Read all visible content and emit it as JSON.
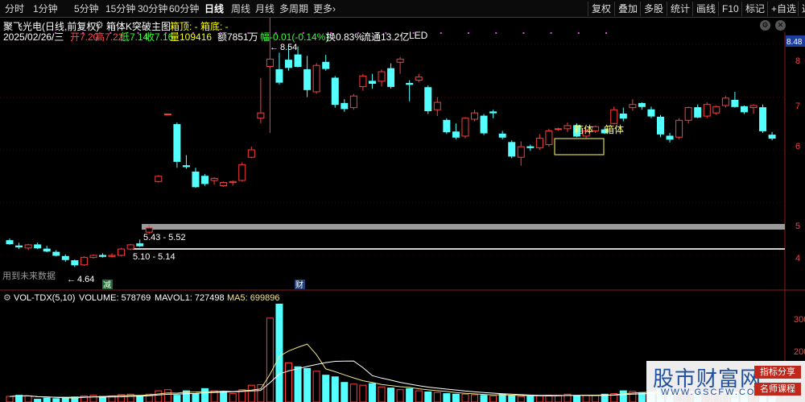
{
  "toolbar": {
    "periods": [
      "分时",
      "1分钟",
      "5分钟",
      "15分钟",
      "30分钟",
      "60分钟",
      "日线",
      "周线",
      "月线",
      "多周期",
      "更多"
    ],
    "active": "日线",
    "more_arrow": "›",
    "right": [
      "复权",
      "叠加",
      "多股",
      "统计",
      "画线",
      "F10",
      "标记",
      "+自选",
      "返回"
    ]
  },
  "header": {
    "stock": "聚飞光电(日线,前复权)",
    "indicator": "箱体K突破主图",
    "box_top": "箱顶: -",
    "box_bottom": "箱底: -",
    "line2": {
      "date": "2025/02/26/三",
      "open": "开7.20",
      "high": "高7.22",
      "low": "低7.14",
      "close": "收7.16",
      "volume": "量109416",
      "amount": "额7851万",
      "change": "幅-0.01(-0.14%)",
      "turnover": "换0.83%",
      "float": "流通13.2亿",
      "sector": "LED"
    }
  },
  "price_axis": {
    "ticks": [
      "8",
      "7",
      "6",
      "5",
      "4"
    ],
    "current": "8.48"
  },
  "annotations": {
    "high_label": "8.54",
    "low_label": "4.64",
    "range1": "5.43 - 5.52",
    "range2": "5.10 - 5.14",
    "box_label1": "箱体",
    "box_label2": "箱体",
    "future_data": "用到未来数据",
    "marker_reduce": "减",
    "marker_fin": "财"
  },
  "volume_header": {
    "name": "VOL-TDX(5,10)",
    "volume": "VOLUME: 578769",
    "mavol1": "MAVOL1: 727498",
    "ma5": "MA5: 699896"
  },
  "volume_axis": {
    "ticks": [
      "300",
      "200"
    ]
  },
  "watermark": {
    "title": "股市财富网",
    "url": "WWW.GSCFW.COM",
    "tag1": "指标分享",
    "tag2": "名师课程"
  },
  "colors": {
    "up": "#ff3c3c",
    "down": "#54ffff",
    "mavol": "#ffffff",
    "ma5": "#f0e68c",
    "box_line": "#999999",
    "dots": "#e040e0"
  },
  "chart_data": {
    "type": "candlestick",
    "candles": [
      {
        "o": 4.28,
        "h": 4.32,
        "l": 4.2,
        "c": 4.22
      },
      {
        "o": 4.18,
        "h": 4.24,
        "l": 4.12,
        "c": 4.16
      },
      {
        "o": 4.14,
        "h": 4.22,
        "l": 4.1,
        "c": 4.2
      },
      {
        "o": 4.2,
        "h": 4.24,
        "l": 4.12,
        "c": 4.14
      },
      {
        "o": 4.12,
        "h": 4.18,
        "l": 4.06,
        "c": 4.08
      },
      {
        "o": 4.06,
        "h": 4.1,
        "l": 3.98,
        "c": 4.0
      },
      {
        "o": 3.98,
        "h": 4.02,
        "l": 3.88,
        "c": 3.92
      },
      {
        "o": 3.9,
        "h": 3.92,
        "l": 3.78,
        "c": 3.82
      },
      {
        "o": 3.82,
        "h": 3.98,
        "l": 3.8,
        "c": 3.96
      },
      {
        "o": 3.96,
        "h": 4.02,
        "l": 3.94,
        "c": 4.0
      },
      {
        "o": 4.0,
        "h": 4.04,
        "l": 3.96,
        "c": 3.98
      },
      {
        "o": 3.98,
        "h": 4.04,
        "l": 3.96,
        "c": 4.0
      },
      {
        "o": 4.0,
        "h": 4.14,
        "l": 3.98,
        "c": 4.12
      },
      {
        "o": 4.12,
        "h": 4.22,
        "l": 4.1,
        "c": 4.2
      },
      {
        "o": 4.22,
        "h": 4.3,
        "l": 4.16,
        "c": 4.18
      },
      {
        "o": 4.44,
        "h": 4.58,
        "l": 4.4,
        "c": 4.52
      },
      {
        "o": 5.4,
        "h": 5.52,
        "l": 5.38,
        "c": 5.5
      },
      {
        "o": 6.68,
        "h": 6.68,
        "l": 6.68,
        "c": 6.68
      },
      {
        "o": 6.48,
        "h": 6.52,
        "l": 5.66,
        "c": 5.78
      },
      {
        "o": 5.7,
        "h": 5.9,
        "l": 5.64,
        "c": 5.68
      },
      {
        "o": 5.58,
        "h": 5.66,
        "l": 5.28,
        "c": 5.3
      },
      {
        "o": 5.5,
        "h": 5.54,
        "l": 5.32,
        "c": 5.36
      },
      {
        "o": 5.42,
        "h": 5.48,
        "l": 5.34,
        "c": 5.46
      },
      {
        "o": 5.32,
        "h": 5.4,
        "l": 5.3,
        "c": 5.38
      },
      {
        "o": 5.38,
        "h": 5.42,
        "l": 5.32,
        "c": 5.4
      },
      {
        "o": 5.42,
        "h": 5.76,
        "l": 5.4,
        "c": 5.72
      },
      {
        "o": 5.86,
        "h": 6.06,
        "l": 5.84,
        "c": 6.0
      },
      {
        "o": 6.6,
        "h": 7.36,
        "l": 6.5,
        "c": 6.7
      },
      {
        "o": 7.58,
        "h": 8.54,
        "l": 6.32,
        "c": 7.72
      },
      {
        "o": 7.52,
        "h": 7.84,
        "l": 7.24,
        "c": 7.28
      },
      {
        "o": 7.7,
        "h": 8.0,
        "l": 7.5,
        "c": 7.56
      },
      {
        "o": 7.8,
        "h": 7.96,
        "l": 7.56,
        "c": 7.58
      },
      {
        "o": 7.52,
        "h": 7.78,
        "l": 7.0,
        "c": 7.14
      },
      {
        "o": 7.1,
        "h": 7.64,
        "l": 7.06,
        "c": 7.6
      },
      {
        "o": 7.66,
        "h": 7.8,
        "l": 7.5,
        "c": 7.54
      },
      {
        "o": 7.36,
        "h": 7.4,
        "l": 6.8,
        "c": 6.86
      },
      {
        "o": 6.88,
        "h": 6.96,
        "l": 6.72,
        "c": 6.78
      },
      {
        "o": 6.8,
        "h": 7.06,
        "l": 6.76,
        "c": 7.02
      },
      {
        "o": 7.2,
        "h": 7.44,
        "l": 7.12,
        "c": 7.4
      },
      {
        "o": 7.3,
        "h": 7.44,
        "l": 7.16,
        "c": 7.26
      },
      {
        "o": 7.3,
        "h": 7.52,
        "l": 7.2,
        "c": 7.48
      },
      {
        "o": 7.54,
        "h": 7.64,
        "l": 7.16,
        "c": 7.2
      },
      {
        "o": 7.66,
        "h": 7.76,
        "l": 7.44,
        "c": 7.72
      },
      {
        "o": 7.26,
        "h": 7.32,
        "l": 6.92,
        "c": 7.24
      },
      {
        "o": 7.32,
        "h": 7.44,
        "l": 7.28,
        "c": 7.38
      },
      {
        "o": 7.18,
        "h": 7.22,
        "l": 6.68,
        "c": 6.74
      },
      {
        "o": 6.76,
        "h": 7.0,
        "l": 6.64,
        "c": 6.9
      },
      {
        "o": 6.56,
        "h": 6.6,
        "l": 6.3,
        "c": 6.34
      },
      {
        "o": 6.34,
        "h": 6.5,
        "l": 6.2,
        "c": 6.24
      },
      {
        "o": 6.26,
        "h": 6.62,
        "l": 6.22,
        "c": 6.6
      },
      {
        "o": 6.58,
        "h": 6.76,
        "l": 6.54,
        "c": 6.7
      },
      {
        "o": 6.64,
        "h": 6.68,
        "l": 6.28,
        "c": 6.32
      },
      {
        "o": 6.72,
        "h": 6.76,
        "l": 6.6,
        "c": 6.7
      },
      {
        "o": 6.3,
        "h": 6.36,
        "l": 6.2,
        "c": 6.24
      },
      {
        "o": 6.14,
        "h": 6.18,
        "l": 5.84,
        "c": 5.88
      },
      {
        "o": 5.86,
        "h": 6.16,
        "l": 5.7,
        "c": 6.06
      },
      {
        "o": 6.06,
        "h": 6.1,
        "l": 5.98,
        "c": 6.04
      },
      {
        "o": 6.04,
        "h": 6.3,
        "l": 6.0,
        "c": 6.22
      },
      {
        "o": 6.1,
        "h": 6.4,
        "l": 6.06,
        "c": 6.36
      },
      {
        "o": 6.4,
        "h": 6.42,
        "l": 6.36,
        "c": 6.4
      },
      {
        "o": 6.4,
        "h": 6.52,
        "l": 6.34,
        "c": 6.46
      },
      {
        "o": 6.46,
        "h": 6.5,
        "l": 6.24,
        "c": 6.26
      },
      {
        "o": 6.26,
        "h": 6.4,
        "l": 6.22,
        "c": 6.36
      },
      {
        "o": 6.36,
        "h": 6.46,
        "l": 6.32,
        "c": 6.44
      },
      {
        "o": 6.38,
        "h": 6.44,
        "l": 6.3,
        "c": 6.32
      },
      {
        "o": 6.5,
        "h": 6.82,
        "l": 6.48,
        "c": 6.76
      },
      {
        "o": 6.68,
        "h": 6.8,
        "l": 6.54,
        "c": 6.6
      },
      {
        "o": 6.8,
        "h": 6.96,
        "l": 6.74,
        "c": 6.86
      },
      {
        "o": 6.88,
        "h": 6.9,
        "l": 6.76,
        "c": 6.82
      },
      {
        "o": 6.76,
        "h": 6.82,
        "l": 6.6,
        "c": 6.64
      },
      {
        "o": 6.62,
        "h": 6.66,
        "l": 6.24,
        "c": 6.3
      },
      {
        "o": 6.26,
        "h": 6.32,
        "l": 6.14,
        "c": 6.2
      },
      {
        "o": 6.24,
        "h": 6.6,
        "l": 6.2,
        "c": 6.56
      },
      {
        "o": 6.56,
        "h": 6.82,
        "l": 6.5,
        "c": 6.8
      },
      {
        "o": 6.8,
        "h": 6.86,
        "l": 6.6,
        "c": 6.62
      },
      {
        "o": 6.64,
        "h": 6.9,
        "l": 6.6,
        "c": 6.86
      },
      {
        "o": 6.7,
        "h": 6.84,
        "l": 6.66,
        "c": 6.82
      },
      {
        "o": 6.84,
        "h": 7.02,
        "l": 6.8,
        "c": 6.98
      },
      {
        "o": 6.94,
        "h": 7.1,
        "l": 6.8,
        "c": 6.82
      },
      {
        "o": 6.82,
        "h": 6.84,
        "l": 6.68,
        "c": 6.72
      },
      {
        "o": 6.8,
        "h": 6.86,
        "l": 6.68,
        "c": 6.84
      },
      {
        "o": 6.8,
        "h": 6.86,
        "l": 6.32,
        "c": 6.36
      },
      {
        "o": 6.28,
        "h": 6.34,
        "l": 6.18,
        "c": 6.22
      }
    ],
    "volume_max": 360,
    "volume_max_note": "in 10k",
    "volumes_up": [
      20,
      24,
      22,
      10,
      14,
      12,
      16,
      18,
      22,
      24,
      20,
      22,
      26,
      28,
      22,
      28,
      40,
      44,
      24,
      40,
      30,
      48,
      40,
      38,
      30,
      44,
      60,
      62,
      300,
      350,
      140,
      126,
      120,
      110,
      96,
      90,
      70,
      64,
      60,
      66,
      54,
      50,
      44,
      48,
      40,
      36,
      34,
      30,
      28,
      28,
      26,
      24,
      22,
      28,
      22,
      20,
      20,
      22,
      24,
      24,
      28,
      22,
      24,
      24,
      28,
      30,
      40,
      38,
      34,
      36,
      44,
      36,
      32,
      30,
      30,
      36,
      38,
      32,
      34,
      44,
      46,
      40,
      38
    ],
    "volumes_color": [
      "u",
      "d",
      "u",
      "d",
      "d",
      "d",
      "d",
      "d",
      "u",
      "u",
      "d",
      "u",
      "u",
      "u",
      "d",
      "u",
      "u",
      "u",
      "d",
      "d",
      "d",
      "d",
      "u",
      "d",
      "u",
      "u",
      "u",
      "u",
      "u",
      "d",
      "u",
      "d",
      "d",
      "u",
      "d",
      "d",
      "d",
      "u",
      "u",
      "d",
      "u",
      "d",
      "u",
      "d",
      "u",
      "d",
      "u",
      "d",
      "d",
      "u",
      "u",
      "d",
      "u",
      "d",
      "d",
      "u",
      "d",
      "u",
      "u",
      "u",
      "u",
      "d",
      "u",
      "u",
      "d",
      "u",
      "d",
      "u",
      "d",
      "d",
      "d",
      "d",
      "u",
      "u",
      "d",
      "u",
      "u",
      "u",
      "d",
      "d",
      "u",
      "d",
      "d"
    ]
  }
}
